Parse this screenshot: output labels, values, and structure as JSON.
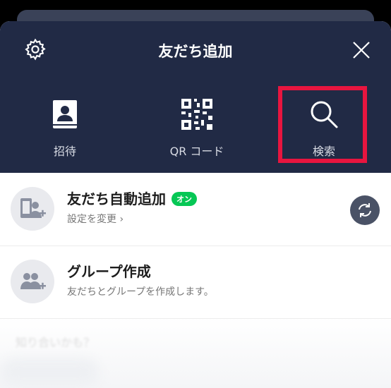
{
  "header": {
    "title": "友だち追加"
  },
  "actions": [
    {
      "label": "招待",
      "icon": "contact-book-icon"
    },
    {
      "label": "QR コード",
      "icon": "qr-code-icon"
    },
    {
      "label": "検索",
      "icon": "search-icon",
      "highlighted": true
    }
  ],
  "highlight_color": "#e8153f",
  "list": [
    {
      "title": "友だち自動追加",
      "badge": "オン",
      "subtitle": "設定を変更",
      "subtitle_arrow": "›",
      "icon": "phone-add-icon"
    },
    {
      "title": "グループ作成",
      "subtitle": "友だちとグループを作成します。",
      "icon": "group-add-icon"
    }
  ],
  "ghost_text": "知り合いかも？",
  "colors": {
    "header_bg": "#212a45",
    "badge": "#06c755"
  }
}
